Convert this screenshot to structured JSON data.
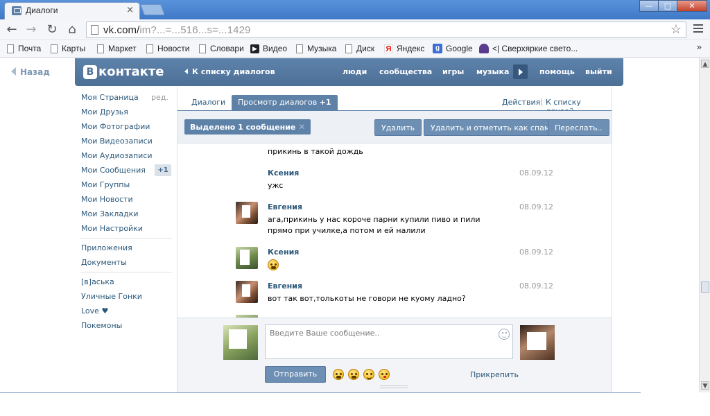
{
  "browser": {
    "tab_title": "Диалоги",
    "tab_close": "×",
    "url_host": "vk.com/",
    "url_rest": "im?...=...516...s=...1429",
    "win_min": "—",
    "win_max": "□",
    "win_close": "✕",
    "bookmarks": [
      "Почта",
      "Карты",
      "Маркет",
      "Новости",
      "Словари",
      "Видео",
      "Музыка",
      "Диск",
      "Яндекс",
      "Google",
      "<| Сверхяркие свето..."
    ],
    "bookmarks_more": "»"
  },
  "vk": {
    "back": "Назад",
    "logo_letter": "В",
    "logo_text": "контакте",
    "to_dialogs": "К списку диалогов",
    "nav": [
      "люди",
      "сообщества",
      "игры",
      "музыка",
      "помощь",
      "выйти"
    ]
  },
  "menu": {
    "items": [
      "Моя Страница",
      "Мои Друзья",
      "Мои Фотографии",
      "Мои Видеозаписи",
      "Мои Аудиозаписи",
      "Мои Сообщения",
      "Мои Группы",
      "Мои Новости",
      "Мои Закладки",
      "Мои Настройки"
    ],
    "edit": "ред.",
    "messages_badge": "+1",
    "apps": [
      "Приложения",
      "Документы"
    ],
    "games": [
      "[в]аська",
      "Уличные Гонки",
      "Love ♥",
      "Покемоны"
    ]
  },
  "tabs": {
    "dialogs": "Диалоги",
    "view": "Просмотр диалогов",
    "view_badge": "+1",
    "actions": "Действия",
    "friends": "К списку друзей"
  },
  "actionbar": {
    "selected": "Выделено 1 сообщение",
    "selected_x": "✕",
    "delete": "Удалить",
    "spam": "Удалить и отметить как спам",
    "forward": "Переслать.."
  },
  "messages": [
    {
      "author": "",
      "date": "",
      "text": "прикинь в такой дождь"
    },
    {
      "author": "Ксения",
      "date": "08.09.12",
      "text": "ужс"
    },
    {
      "author": "Евгения",
      "date": "08.09.12",
      "text": "ага,прикинь у нас короче парни купили пиво и пили прямо при училке,а потом и ей налили"
    },
    {
      "author": "Ксения",
      "date": "08.09.12",
      "text": ""
    },
    {
      "author": "Евгения",
      "date": "08.09.12",
      "text": "вот так вот,толькоты не говори не куому ладно?"
    }
  ],
  "compose": {
    "placeholder": "Введите Ваше сообщение..",
    "send": "Отправить",
    "attach": "Прикрепить"
  }
}
